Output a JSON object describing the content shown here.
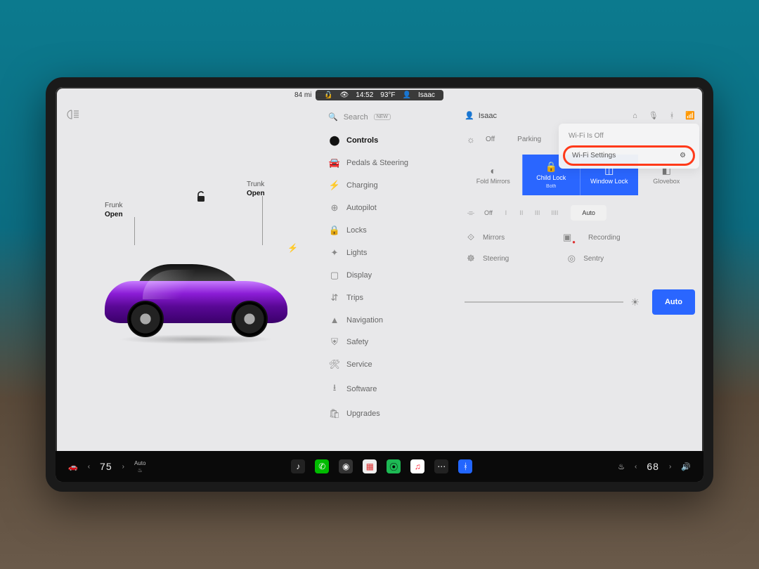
{
  "status": {
    "range_mi": "84 mi",
    "time": "14:52",
    "temp": "93°F",
    "profile": "Isaac"
  },
  "carpane": {
    "frunk_label": "Frunk",
    "frunk_state": "Open",
    "trunk_label": "Trunk",
    "trunk_state": "Open"
  },
  "search": {
    "placeholder": "Search",
    "badge": "NEW"
  },
  "nav": {
    "controls": "Controls",
    "pedals": "Pedals & Steering",
    "charging": "Charging",
    "autopilot": "Autopilot",
    "locks": "Locks",
    "lights": "Lights",
    "display": "Display",
    "trips": "Trips",
    "navigation": "Navigation",
    "safety": "Safety",
    "service": "Service",
    "software": "Software",
    "upgrades": "Upgrades"
  },
  "content": {
    "profile_name": "Isaac",
    "lights_off": "Off",
    "lights_parking": "Parking",
    "tiles": {
      "fold_mirrors": "Fold Mirrors",
      "child_lock": "Child Lock",
      "child_lock_sub": "Both",
      "window_lock": "Window Lock",
      "glovebox": "Glovebox"
    },
    "wipers": {
      "off": "Off",
      "l1": "I",
      "l2": "II",
      "l3": "III",
      "l4": "IIII",
      "auto": "Auto"
    },
    "mirrors": "Mirrors",
    "recording": "Recording",
    "steering": "Steering",
    "sentry": "Sentry",
    "brightness_auto": "Auto"
  },
  "wifi": {
    "status": "Wi-Fi Is Off",
    "settings": "Wi-Fi Settings"
  },
  "dock": {
    "seat_auto": "Auto",
    "temp_left": "75",
    "temp_right": "68"
  }
}
